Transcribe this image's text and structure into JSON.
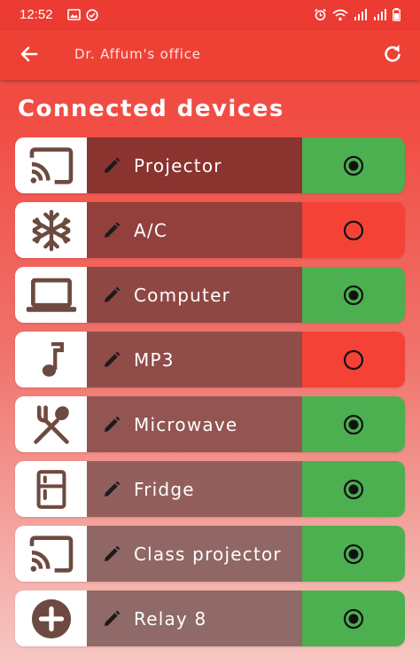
{
  "status": {
    "time": "12:52"
  },
  "appbar": {
    "title": "Dr. Affum's office"
  },
  "section": {
    "title": "Connected devices"
  },
  "colors": {
    "on": "#4caf50",
    "off": "#f44336",
    "name_bg": [
      "#8a332f",
      "#93403c",
      "#8f4743",
      "#8f4c49",
      "#925552",
      "#935f5c",
      "#906764",
      "#8f6a68"
    ],
    "icon_fill": "#6d4a40"
  },
  "devices": [
    {
      "name": "Projector",
      "icon": "cast-icon",
      "state": "on"
    },
    {
      "name": "A/C",
      "icon": "snowflake-icon",
      "state": "off"
    },
    {
      "name": "Computer",
      "icon": "laptop-icon",
      "state": "on"
    },
    {
      "name": "MP3",
      "icon": "music-note-icon",
      "state": "off"
    },
    {
      "name": "Microwave",
      "icon": "fork-spoon-icon",
      "state": "on"
    },
    {
      "name": "Fridge",
      "icon": "fridge-icon",
      "state": "on"
    },
    {
      "name": "Class projector",
      "icon": "cast-icon",
      "state": "on"
    },
    {
      "name": "Relay 8",
      "icon": "add-circle-icon",
      "state": "on"
    }
  ]
}
